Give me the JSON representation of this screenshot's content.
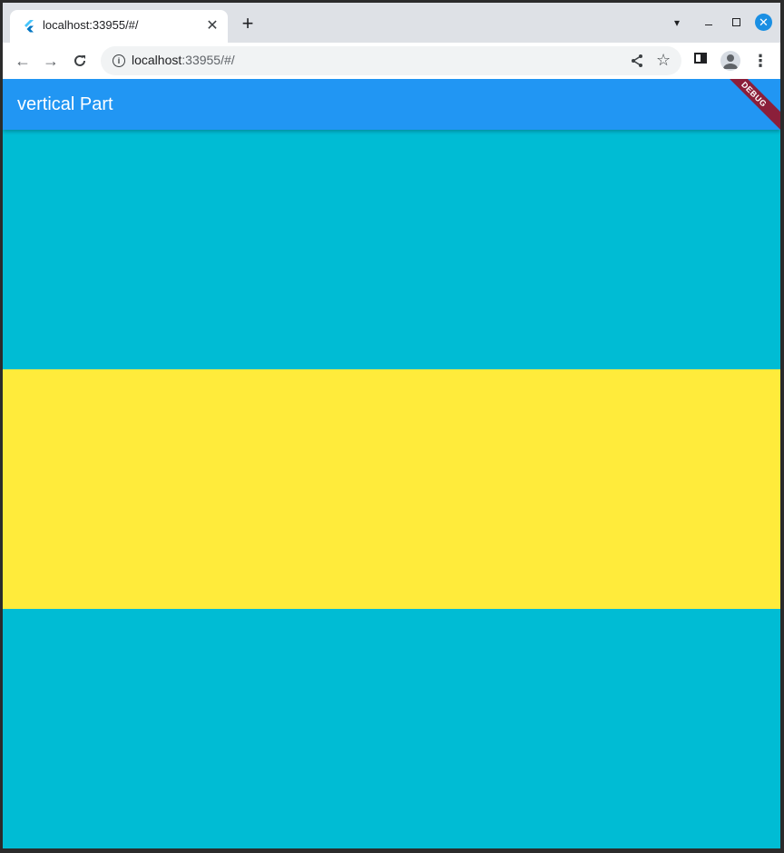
{
  "browser": {
    "tab": {
      "title": "localhost:33955/#/"
    },
    "url": {
      "host": "localhost",
      "rest": ":33955/#/"
    }
  },
  "app": {
    "title": "vertical Part",
    "debug_banner": "DEBUG",
    "colors": {
      "appbar": "#2196f3",
      "panel_top": "#00bcd4",
      "panel_middle": "#ffeb3b",
      "panel_bottom": "#00bcd4"
    }
  }
}
